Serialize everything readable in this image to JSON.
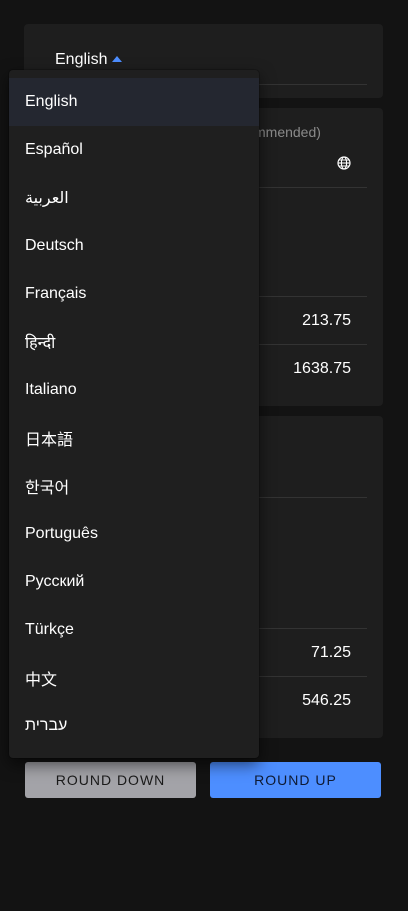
{
  "language_selector": {
    "current": "English",
    "caret_icon": "caret-up-icon",
    "options": [
      "English",
      "Español",
      "العربية",
      "Deutsch",
      "Français",
      "हिन्दी",
      "Italiano",
      "日本語",
      "한국어",
      "Português",
      "Русский",
      "Türkçe",
      "中文",
      "עברית"
    ],
    "selected_index": 0
  },
  "card_a": {
    "hint": "mmended)",
    "globe_icon": "globe-icon",
    "values": [
      "213.75",
      "1638.75"
    ]
  },
  "card_b": {
    "values": [
      "71.25",
      "546.25"
    ]
  },
  "actions": {
    "round_down_label": "ROUND DOWN",
    "round_up_label": "ROUND UP"
  },
  "colors": {
    "background": "#131313",
    "card": "#1e1e1e",
    "menu": "#1f1f1f",
    "accent": "#4d8eff",
    "secondary_button": "#a3a3a8"
  }
}
